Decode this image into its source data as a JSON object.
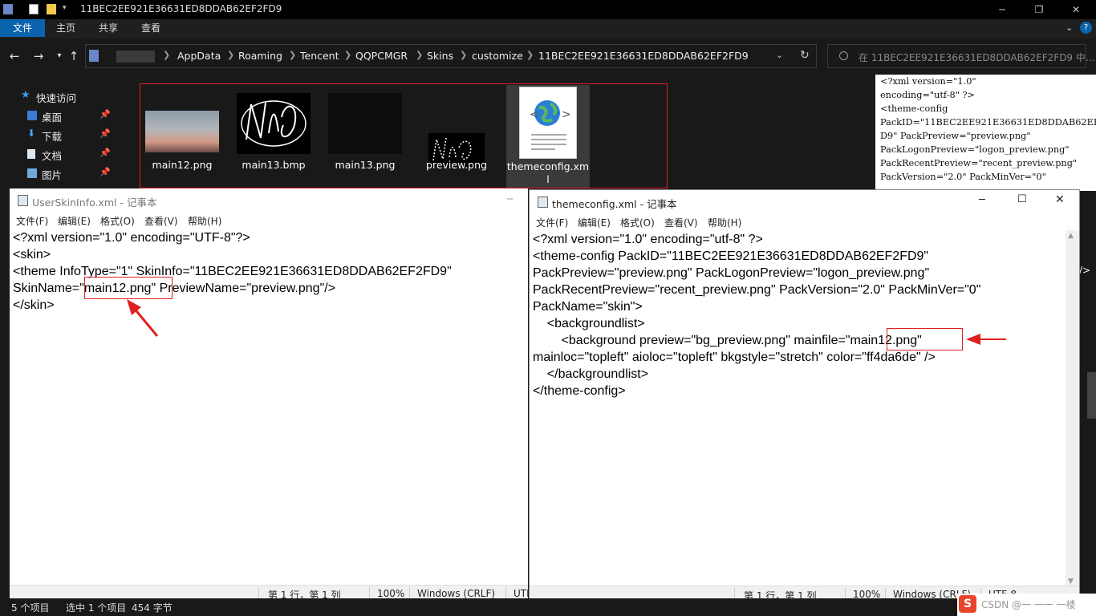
{
  "explorer": {
    "window_title": "11BEC2EE921E36631ED8DDAB62EF2FD9",
    "ribbon_tabs": [
      "文件",
      "主页",
      "共享",
      "查看"
    ],
    "breadcrumbs": [
      "AppData",
      "Roaming",
      "Tencent",
      "QQPCMGR",
      "Skins",
      "customize",
      "11BEC2EE921E36631ED8DDAB62EF2FD9"
    ],
    "search_placeholder": "在 11BEC2EE921E36631ED8DDAB62EF2FD9 中...",
    "nav": {
      "quick_access": "快速访问",
      "items": [
        "桌面",
        "下载",
        "文档",
        "图片"
      ]
    },
    "files": [
      {
        "name": "main12.png",
        "thumb": "sunset-image"
      },
      {
        "name": "main13.bmp",
        "thumb": "scribble-image"
      },
      {
        "name": "main13.png",
        "thumb": "black-image"
      },
      {
        "name": "preview.png",
        "thumb": "scribble-small-image"
      },
      {
        "name": "themeconfig.xml",
        "thumb": "xml-file-icon"
      }
    ],
    "preview_text": [
      "<?xml version=\"1.0\"",
      "encoding=\"utf-8\" ?>",
      "<theme-config",
      "PackID=\"11BEC2EE921E36631ED8DDAB62EF2F",
      "D9\" PackPreview=\"preview.png\"",
      "PackLogonPreview=\"logon_preview.png\"",
      "PackRecentPreview=\"recent_preview.png\"",
      "PackVersion=\"2.0\" PackMinVer=\"0\""
    ],
    "status": {
      "count": "5 个项目",
      "selected": "选中 1 个项目",
      "size": "454 字节"
    }
  },
  "notepad_left": {
    "title": "UserSkinInfo.xml - 记事本",
    "menu": [
      "文件(F)",
      "编辑(E)",
      "格式(O)",
      "查看(V)",
      "帮助(H)"
    ],
    "lines": [
      "<?xml version=\"1.0\" encoding=\"UTF-8\"?>",
      "<skin>",
      "<theme InfoType=\"1\" SkinInfo=\"11BEC2EE921E36631ED8DDAB62EF2FD9\"",
      "SkinName=\"main12.png\" PreviewName=\"preview.png\"/>",
      "</skin>"
    ],
    "status": {
      "position": "第 1 行，第 1 列",
      "zoom": "100%",
      "eol": "Windows (CRLF)",
      "encoding": "UTF"
    }
  },
  "notepad_right": {
    "title": "themeconfig.xml - 记事本",
    "menu": [
      "文件(F)",
      "编辑(E)",
      "格式(O)",
      "查看(V)",
      "帮助(H)"
    ],
    "lines": [
      "<?xml version=\"1.0\" encoding=\"utf-8\" ?>",
      "<theme-config PackID=\"11BEC2EE921E36631ED8DDAB62EF2FD9\"",
      "PackPreview=\"preview.png\" PackLogonPreview=\"logon_preview.png\"",
      "PackRecentPreview=\"recent_preview.png\" PackVersion=\"2.0\" PackMinVer=\"0\"",
      "PackName=\"skin\">",
      "    <backgroundlist>",
      "        <background preview=\"bg_preview.png\" mainfile=\"main12.png\"",
      "mainloc=\"topleft\" aioloc=\"topleft\" bkgstyle=\"stretch\" color=\"ff4da6de\" />",
      "    </backgroundlist>",
      "</theme-config>"
    ],
    "status": {
      "position": "第 1 行，第 1 列",
      "zoom": "100%",
      "eol": "Windows (CRLF)",
      "encoding": "UTF-8"
    }
  },
  "watermark": "CSDN @一 一一 一楼",
  "colors": {
    "highlight": "#e02020",
    "ribbon_active": "#0a64ad",
    "dark_bg": "#191919"
  }
}
